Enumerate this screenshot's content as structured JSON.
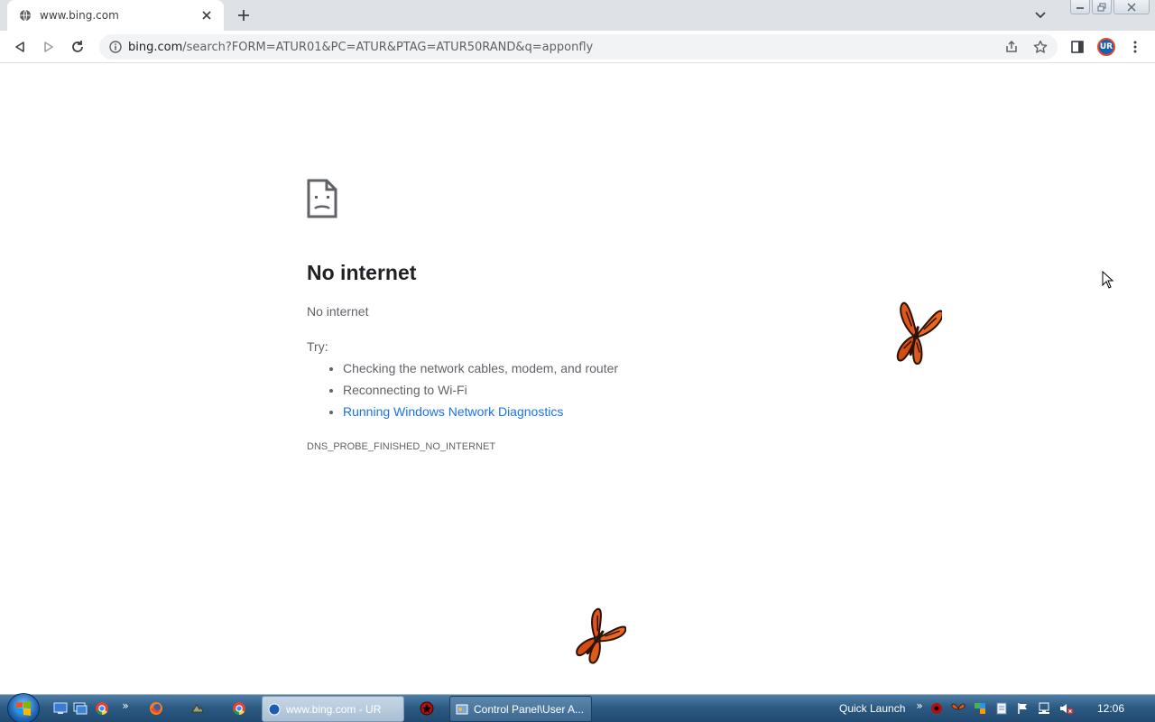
{
  "browser": {
    "tab": {
      "title": "www.bing.com",
      "favicon": "globe-icon"
    },
    "address": {
      "host": "bing.com",
      "path": "/search?FORM=ATUR01&PC=ATUR&PTAG=ATUR50RAND&q=apponfly"
    },
    "profile_initials": "UR"
  },
  "error_page": {
    "title": "No internet",
    "subtitle": "No internet",
    "try_label": "Try:",
    "suggestions": [
      "Checking the network cables, modem, and router",
      "Reconnecting to Wi-Fi"
    ],
    "link": "Running Windows Network Diagnostics",
    "error_code": "DNS_PROBE_FINISHED_NO_INTERNET",
    "link_color": "#1a73e8"
  },
  "taskbar": {
    "items": [
      {
        "label": "www.bing.com - UR",
        "state": "active"
      },
      {
        "label": "Control Panel\\User A...",
        "state": "normal"
      }
    ],
    "chevron": "»",
    "quick_launch": "Quick Launch",
    "clock": "12:06"
  },
  "colors": {
    "taskbar": "#2c5a83",
    "tabstrip": "#dee1e6",
    "butterfly": "#e0561a"
  }
}
